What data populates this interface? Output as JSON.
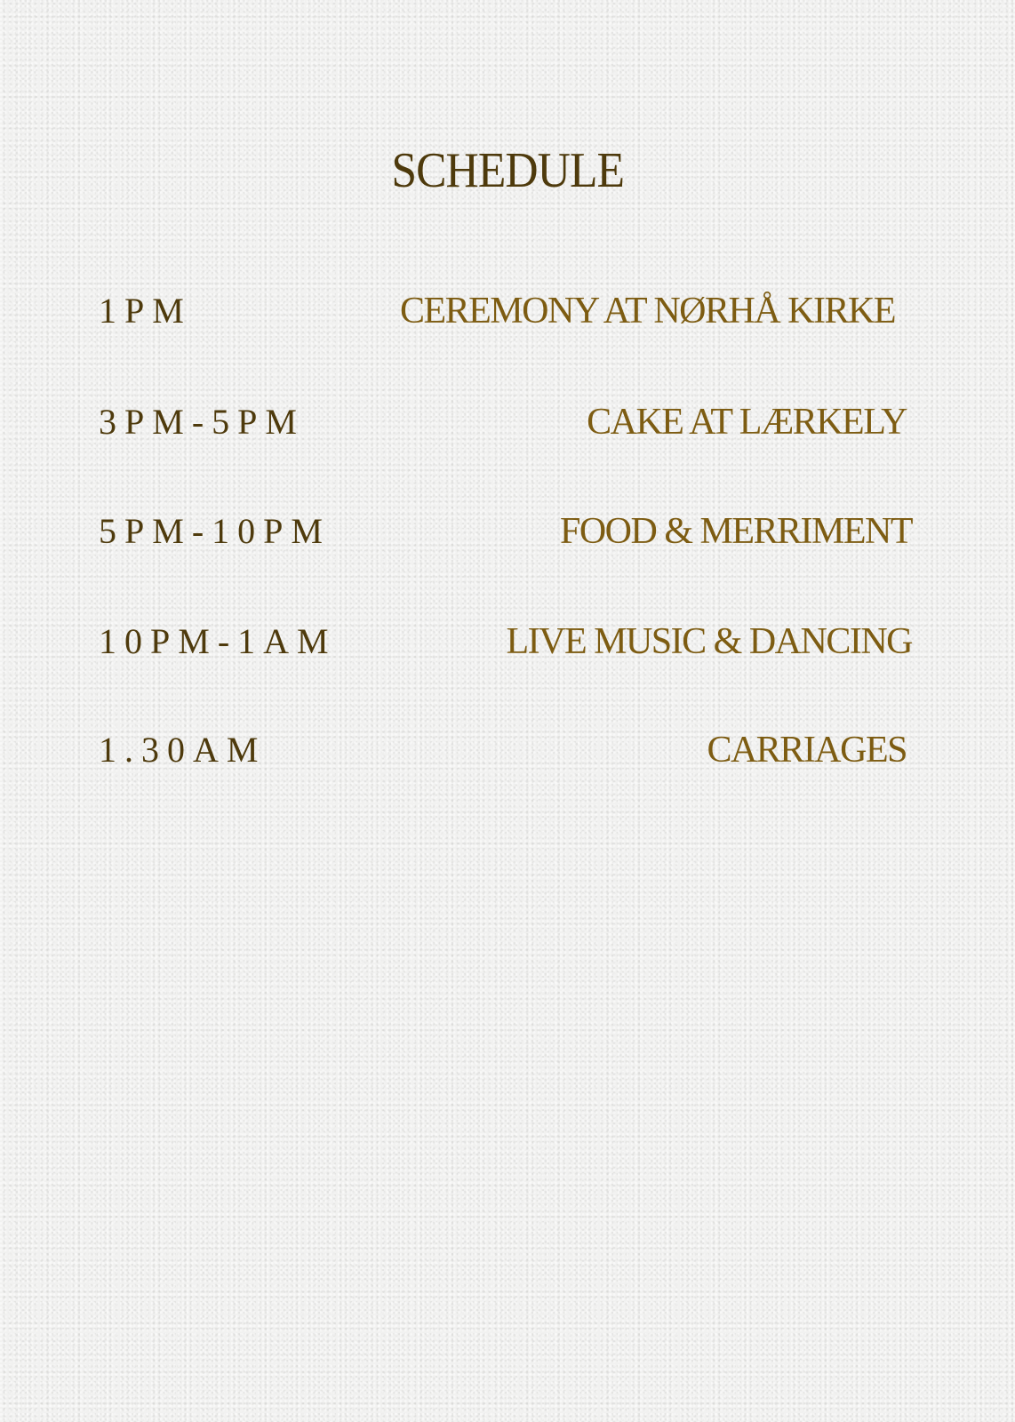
{
  "title": "SCHEDULE",
  "schedule": [
    {
      "time": "1PM",
      "event": "CEREMONY AT NØRHÅ KIRKE"
    },
    {
      "time": "3PM-5PM",
      "event": "CAKE AT LÆRKELY"
    },
    {
      "time": "5PM-10PM",
      "event": "FOOD & MERRIMENT"
    },
    {
      "time": "10PM-1AM",
      "event": "LIVE MUSIC & DANCING"
    },
    {
      "time": "1.30AM",
      "event": "CARRIAGES"
    }
  ],
  "colors": {
    "background": "#f1f1f0",
    "title": "#4e3a0c",
    "time": "#4e3a0c",
    "event": "#7d5c12"
  }
}
